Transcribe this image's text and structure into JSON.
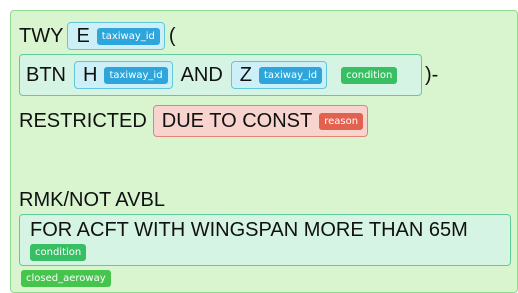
{
  "line1": {
    "prefix": "TWY",
    "taxiway": {
      "value": "E",
      "tag": "taxiway_id"
    },
    "open_paren": "("
  },
  "between": {
    "prefix": "BTN",
    "taxiway1": {
      "value": "H",
      "tag": "taxiway_id"
    },
    "conjunction": "AND",
    "taxiway2": {
      "value": "Z",
      "tag": "taxiway_id"
    },
    "tag": "condition",
    "close": ")-"
  },
  "restriction": {
    "text": "RESTRICTED",
    "reason": {
      "value": "DUE TO CONST",
      "tag": "reason"
    }
  },
  "remark": {
    "text": "RMK/NOT AVBL",
    "condition": {
      "value": "FOR ACFT WITH WINGSPAN MORE THAN 65M",
      "tag": "condition"
    }
  },
  "outer_tag": "closed_aeroway",
  "colors": {
    "outer_bg": "#d8f5d0",
    "taxiway_bg": "#cdeff7",
    "condition_bg": "#d6f4e4",
    "reason_bg": "#f8d4cf",
    "tag_blue": "#2fa6db",
    "tag_green": "#39bf63",
    "tag_red": "#e2624f"
  }
}
